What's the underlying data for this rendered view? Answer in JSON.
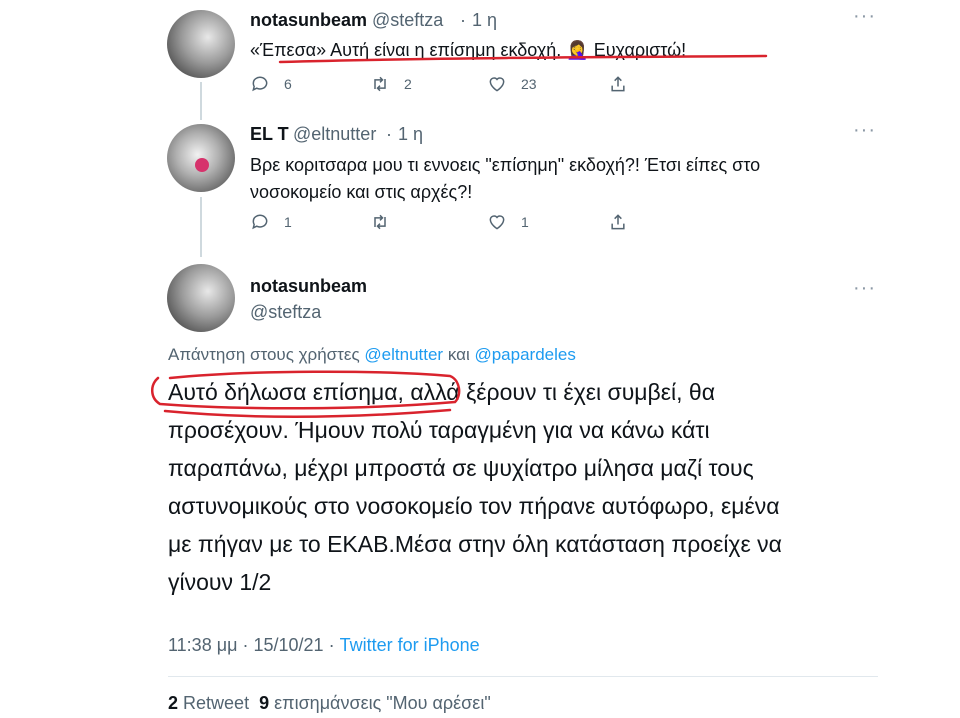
{
  "tweets": [
    {
      "name": "notasunbeam",
      "handle": "@steftza",
      "time": "1 η",
      "text": "«Έπεσα» Αυτή είναι η επίσημη εκδοχή. 🤦‍♀️ Ευχαριστώ!",
      "replies": "6",
      "retweets": "2",
      "likes": "23"
    },
    {
      "name": "EL T",
      "handle": "@eltnutter",
      "time": "1 η",
      "text_line1": "Βρε κοριτσαρα μου τι εννοεις \"επίσημη\" εκδοχή?! Έτσι είπες στο",
      "text_line2": "νοσοκομείο και στις αρχές?!",
      "replies": "1",
      "retweets": "",
      "likes": "1"
    }
  ],
  "main": {
    "name": "notasunbeam",
    "handle": "@steftza",
    "reply_prefix": "Απάντηση στους χρήστες",
    "mention1": "@eltnutter",
    "conj": "και",
    "mention2": "@papardeles",
    "lines": [
      "Αυτό δήλωσα επίσημα, αλλά ξέρουν τι έχει συμβεί, θα",
      "προσέχουν. Ήμουν πολύ ταραγμένη για να κάνω κάτι",
      "παραπάνω, μέχρι μπροστά σε ψυχίατρο μίλησα μαζί τους",
      "αστυνομικούς στο νοσοκομείο τον πήρανε αυτόφωρο, εμένα",
      "με πήγαν με το ΕΚΑΒ.Μέσα στην όλη κατάσταση προείχε να",
      "γίνουν 1/2"
    ],
    "time": "11:38 μμ",
    "date": "15/10/21",
    "source": "Twitter for iPhone",
    "retweet_count": "2",
    "retweet_label": "Retweet",
    "like_count": "9",
    "like_label": "επισημάνσεις \"Μου αρέσει\""
  },
  "colors": {
    "accent": "#1d9bf0",
    "secondary_text": "#536471",
    "annotation": "#d9232d"
  },
  "icons": [
    "reply-icon",
    "retweet-icon",
    "like-icon",
    "share-icon",
    "more-icon"
  ]
}
